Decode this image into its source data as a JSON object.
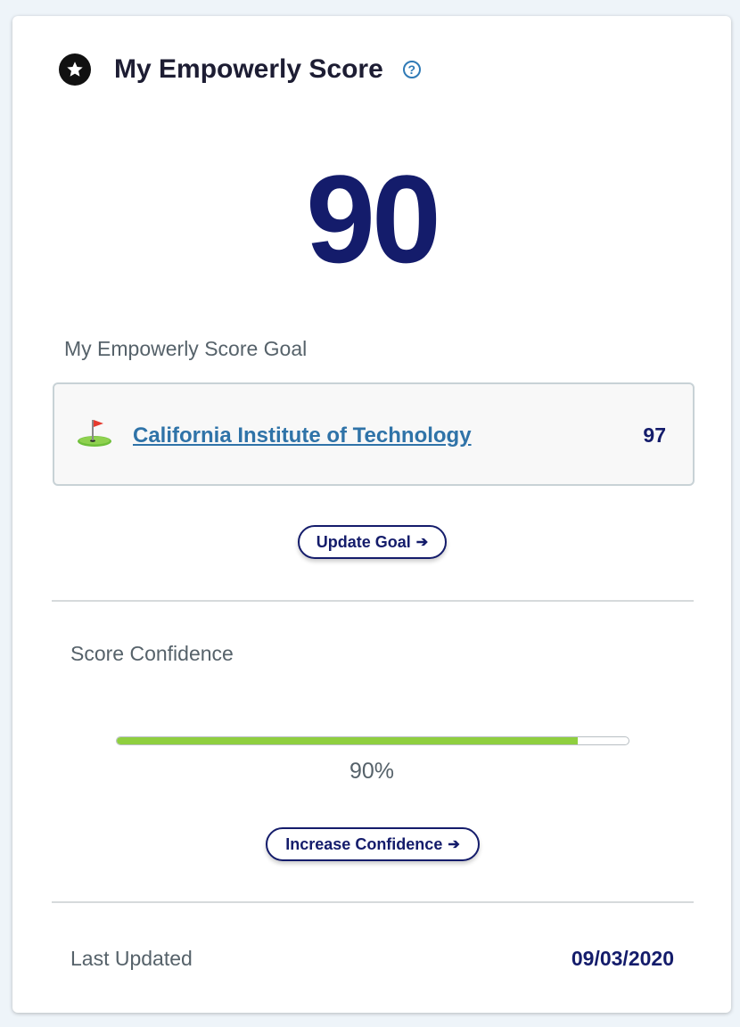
{
  "header": {
    "title": "My Empowerly Score",
    "icon": "star-icon",
    "help_icon": "question-circle-icon",
    "help_glyph": "?"
  },
  "score": {
    "value": "90"
  },
  "goal": {
    "label": "My Empowerly Score Goal",
    "icon": "golf-flag-icon",
    "school": "California Institute of Technology",
    "school_score": "97",
    "button_label": "Update Goal",
    "button_arrow": "➔"
  },
  "confidence": {
    "label": "Score Confidence",
    "fraction": 0.9,
    "value_text": "90%",
    "button_label": "Increase Confidence",
    "button_arrow": "➔"
  },
  "footer": {
    "label": "Last Updated",
    "date": "09/03/2020"
  },
  "colors": {
    "navy": "#141c6b",
    "link_blue": "#2f73a8",
    "progress_green": "#8fcf3f",
    "muted_text": "#56626a"
  }
}
